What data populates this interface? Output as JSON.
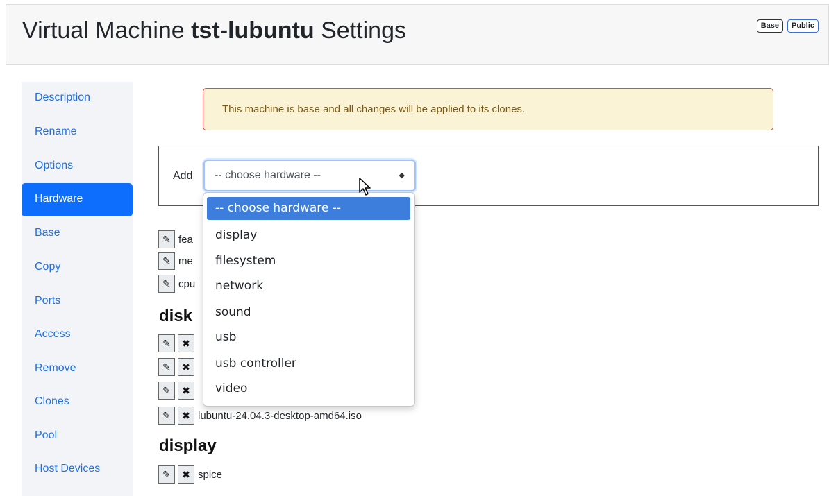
{
  "header": {
    "title_prefix": "Virtual Machine",
    "vm_name": "tst-lubuntu",
    "title_suffix": "Settings",
    "badges": [
      "Base",
      "Public"
    ]
  },
  "sidebar": {
    "items": [
      {
        "label": "Description"
      },
      {
        "label": "Rename"
      },
      {
        "label": "Options"
      },
      {
        "label": "Hardware",
        "active": true
      },
      {
        "label": "Base"
      },
      {
        "label": "Copy"
      },
      {
        "label": "Ports"
      },
      {
        "label": "Access"
      },
      {
        "label": "Remove"
      },
      {
        "label": "Clones"
      },
      {
        "label": "Pool"
      },
      {
        "label": "Host Devices"
      }
    ]
  },
  "alert": {
    "text": "This machine is base and all changes will be applied to its clones."
  },
  "add_hardware": {
    "label": "Add",
    "selected": "-- choose hardware --",
    "options": [
      "-- choose hardware --",
      "display",
      "filesystem",
      "network",
      "sound",
      "usb",
      "usb controller",
      "video"
    ]
  },
  "hardware_rows": {
    "top": [
      {
        "text": "fea"
      },
      {
        "text": "me"
      },
      {
        "text": "cpu"
      }
    ],
    "disk_heading": "disk",
    "disk": [
      {
        "text": ""
      },
      {
        "text": ""
      },
      {
        "text": ""
      },
      {
        "text": "lubuntu-24.04.3-desktop-amd64.iso"
      }
    ],
    "display_heading": "display",
    "display": [
      {
        "text": "spice"
      }
    ]
  },
  "icons": {
    "edit": "pencil-icon",
    "remove": "close-icon",
    "select": "updown-caret-icon",
    "cursor": "mouse-pointer-icon"
  },
  "colors": {
    "primary": "#0d6efd",
    "link": "#1f6fe6",
    "alert_bg": "#fbf3d5",
    "alert_border": "#e0484d"
  }
}
